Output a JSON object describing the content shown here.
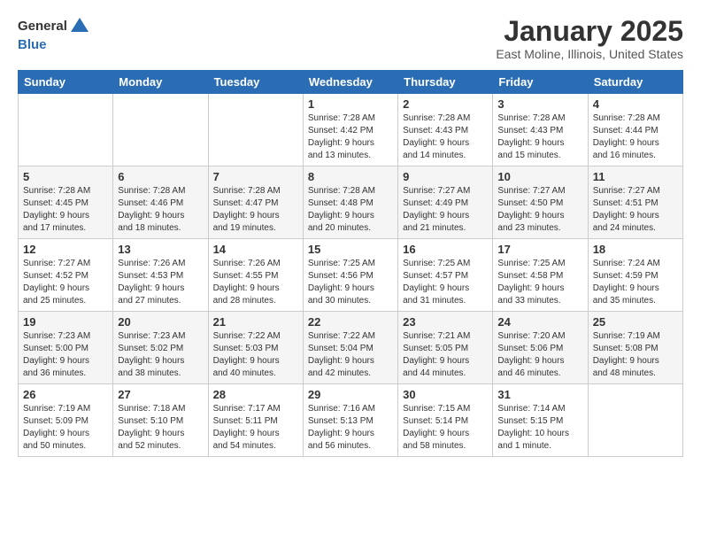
{
  "header": {
    "logo_general": "General",
    "logo_blue": "Blue",
    "month_title": "January 2025",
    "location": "East Moline, Illinois, United States"
  },
  "days_of_week": [
    "Sunday",
    "Monday",
    "Tuesday",
    "Wednesday",
    "Thursday",
    "Friday",
    "Saturday"
  ],
  "weeks": [
    [
      {
        "day": "",
        "detail": ""
      },
      {
        "day": "",
        "detail": ""
      },
      {
        "day": "",
        "detail": ""
      },
      {
        "day": "1",
        "detail": "Sunrise: 7:28 AM\nSunset: 4:42 PM\nDaylight: 9 hours\nand 13 minutes."
      },
      {
        "day": "2",
        "detail": "Sunrise: 7:28 AM\nSunset: 4:43 PM\nDaylight: 9 hours\nand 14 minutes."
      },
      {
        "day": "3",
        "detail": "Sunrise: 7:28 AM\nSunset: 4:43 PM\nDaylight: 9 hours\nand 15 minutes."
      },
      {
        "day": "4",
        "detail": "Sunrise: 7:28 AM\nSunset: 4:44 PM\nDaylight: 9 hours\nand 16 minutes."
      }
    ],
    [
      {
        "day": "5",
        "detail": "Sunrise: 7:28 AM\nSunset: 4:45 PM\nDaylight: 9 hours\nand 17 minutes."
      },
      {
        "day": "6",
        "detail": "Sunrise: 7:28 AM\nSunset: 4:46 PM\nDaylight: 9 hours\nand 18 minutes."
      },
      {
        "day": "7",
        "detail": "Sunrise: 7:28 AM\nSunset: 4:47 PM\nDaylight: 9 hours\nand 19 minutes."
      },
      {
        "day": "8",
        "detail": "Sunrise: 7:28 AM\nSunset: 4:48 PM\nDaylight: 9 hours\nand 20 minutes."
      },
      {
        "day": "9",
        "detail": "Sunrise: 7:27 AM\nSunset: 4:49 PM\nDaylight: 9 hours\nand 21 minutes."
      },
      {
        "day": "10",
        "detail": "Sunrise: 7:27 AM\nSunset: 4:50 PM\nDaylight: 9 hours\nand 23 minutes."
      },
      {
        "day": "11",
        "detail": "Sunrise: 7:27 AM\nSunset: 4:51 PM\nDaylight: 9 hours\nand 24 minutes."
      }
    ],
    [
      {
        "day": "12",
        "detail": "Sunrise: 7:27 AM\nSunset: 4:52 PM\nDaylight: 9 hours\nand 25 minutes."
      },
      {
        "day": "13",
        "detail": "Sunrise: 7:26 AM\nSunset: 4:53 PM\nDaylight: 9 hours\nand 27 minutes."
      },
      {
        "day": "14",
        "detail": "Sunrise: 7:26 AM\nSunset: 4:55 PM\nDaylight: 9 hours\nand 28 minutes."
      },
      {
        "day": "15",
        "detail": "Sunrise: 7:25 AM\nSunset: 4:56 PM\nDaylight: 9 hours\nand 30 minutes."
      },
      {
        "day": "16",
        "detail": "Sunrise: 7:25 AM\nSunset: 4:57 PM\nDaylight: 9 hours\nand 31 minutes."
      },
      {
        "day": "17",
        "detail": "Sunrise: 7:25 AM\nSunset: 4:58 PM\nDaylight: 9 hours\nand 33 minutes."
      },
      {
        "day": "18",
        "detail": "Sunrise: 7:24 AM\nSunset: 4:59 PM\nDaylight: 9 hours\nand 35 minutes."
      }
    ],
    [
      {
        "day": "19",
        "detail": "Sunrise: 7:23 AM\nSunset: 5:00 PM\nDaylight: 9 hours\nand 36 minutes."
      },
      {
        "day": "20",
        "detail": "Sunrise: 7:23 AM\nSunset: 5:02 PM\nDaylight: 9 hours\nand 38 minutes."
      },
      {
        "day": "21",
        "detail": "Sunrise: 7:22 AM\nSunset: 5:03 PM\nDaylight: 9 hours\nand 40 minutes."
      },
      {
        "day": "22",
        "detail": "Sunrise: 7:22 AM\nSunset: 5:04 PM\nDaylight: 9 hours\nand 42 minutes."
      },
      {
        "day": "23",
        "detail": "Sunrise: 7:21 AM\nSunset: 5:05 PM\nDaylight: 9 hours\nand 44 minutes."
      },
      {
        "day": "24",
        "detail": "Sunrise: 7:20 AM\nSunset: 5:06 PM\nDaylight: 9 hours\nand 46 minutes."
      },
      {
        "day": "25",
        "detail": "Sunrise: 7:19 AM\nSunset: 5:08 PM\nDaylight: 9 hours\nand 48 minutes."
      }
    ],
    [
      {
        "day": "26",
        "detail": "Sunrise: 7:19 AM\nSunset: 5:09 PM\nDaylight: 9 hours\nand 50 minutes."
      },
      {
        "day": "27",
        "detail": "Sunrise: 7:18 AM\nSunset: 5:10 PM\nDaylight: 9 hours\nand 52 minutes."
      },
      {
        "day": "28",
        "detail": "Sunrise: 7:17 AM\nSunset: 5:11 PM\nDaylight: 9 hours\nand 54 minutes."
      },
      {
        "day": "29",
        "detail": "Sunrise: 7:16 AM\nSunset: 5:13 PM\nDaylight: 9 hours\nand 56 minutes."
      },
      {
        "day": "30",
        "detail": "Sunrise: 7:15 AM\nSunset: 5:14 PM\nDaylight: 9 hours\nand 58 minutes."
      },
      {
        "day": "31",
        "detail": "Sunrise: 7:14 AM\nSunset: 5:15 PM\nDaylight: 10 hours\nand 1 minute."
      },
      {
        "day": "",
        "detail": ""
      }
    ]
  ]
}
